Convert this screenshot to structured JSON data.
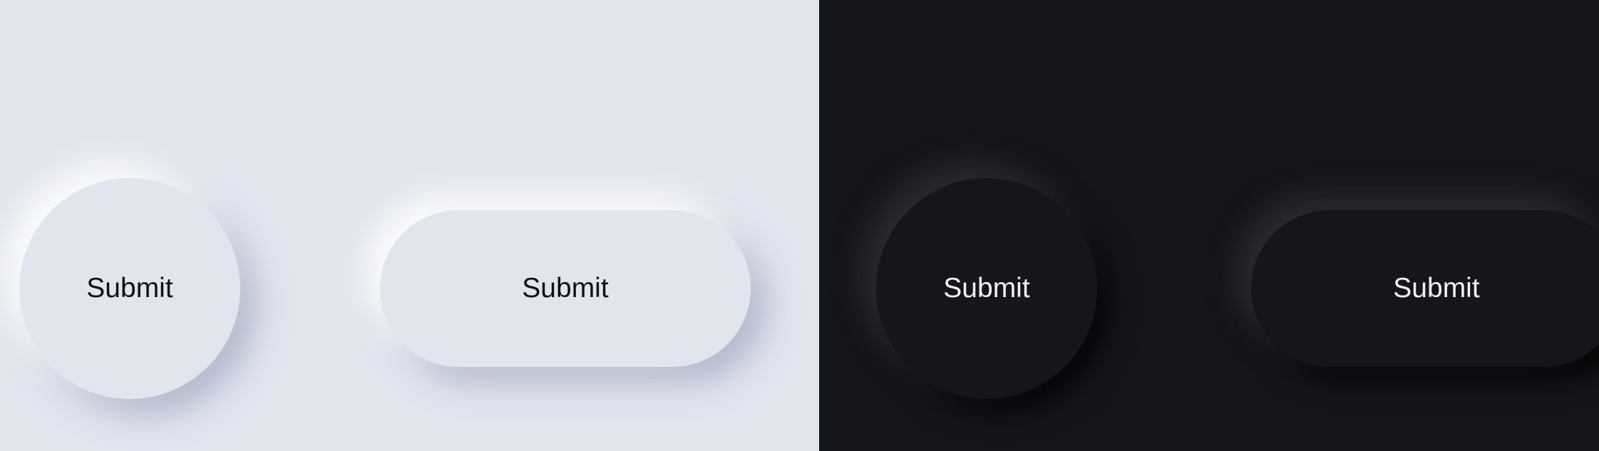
{
  "themes": {
    "light": {
      "background": "#e1e5ee",
      "text_color": "#111111",
      "buttons": [
        {
          "shape": "circle",
          "label": "Submit"
        },
        {
          "shape": "pill",
          "label": "Submit"
        }
      ]
    },
    "dark": {
      "background": "#15161b",
      "text_color": "#f2f2f2",
      "buttons": [
        {
          "shape": "circle",
          "label": "Submit"
        },
        {
          "shape": "pill",
          "label": "Submit"
        }
      ]
    }
  }
}
